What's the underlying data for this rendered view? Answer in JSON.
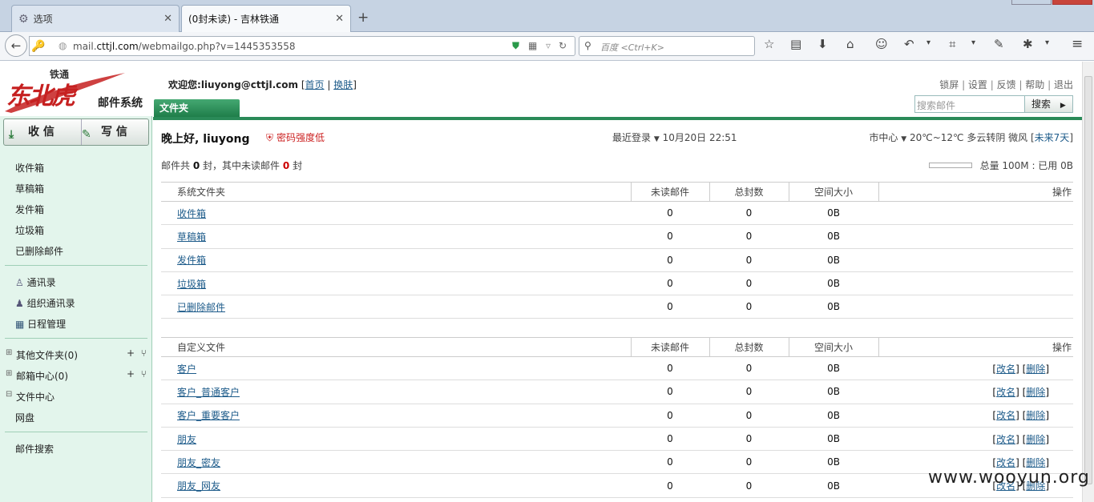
{
  "browser": {
    "tabs": [
      {
        "label": "选项"
      },
      {
        "label": "(0封未读) - 吉林铁通"
      }
    ],
    "url_prefix": "mail.",
    "url_domain": "cttjl.com",
    "url_path": "/webmailgo.php?v=1445353558",
    "search_placeholder": "百度 <Ctrl+K>"
  },
  "logo": {
    "top_text": "铁通",
    "main_text": "东北虎",
    "sub_text": "邮件系统"
  },
  "sidebar": {
    "receive_label": "收 信",
    "write_label": "写 信",
    "mail_items": [
      "收件箱",
      "草稿箱",
      "发件箱",
      "垃圾箱",
      "已删除邮件"
    ],
    "tool_items": [
      "通讯录",
      "组织通讯录",
      "日程管理"
    ],
    "tree_items": [
      "其他文件夹(0)",
      "邮箱中心(0)",
      "文件中心"
    ],
    "netdisk": "网盘",
    "mail_search": "邮件搜索"
  },
  "header": {
    "welcome_prefix": "欢迎您:",
    "user_email": "liuyong@cttjl.com",
    "home_link": "首页",
    "skin_link": "换肤",
    "top_links": [
      "锁屏",
      "设置",
      "反馈",
      "帮助",
      "退出"
    ],
    "search_placeholder": "搜索邮件",
    "search_button": "搜索",
    "folder_tab": "文件夹"
  },
  "main": {
    "greeting": "晚上好, liuyong",
    "password_warning": "密码强度低",
    "last_login_label": "最近登录",
    "last_login_time": "10月20日 22:51",
    "city": "市中心",
    "weather": "20℃~12℃ 多云转阴 微风",
    "forecast_link": "未来7天",
    "summary_prefix": "邮件共",
    "summary_total": "0",
    "summary_mid": "封，其中未读邮件",
    "summary_unread": "0",
    "summary_suffix": "封",
    "quota_text": "总量 100M : 已用 0B"
  },
  "system_table": {
    "headers": [
      "系统文件夹",
      "未读邮件",
      "总封数",
      "空间大小",
      "操作"
    ],
    "rows": [
      {
        "name": "收件箱",
        "unread": "0",
        "total": "0",
        "size": "0B"
      },
      {
        "name": "草稿箱",
        "unread": "0",
        "total": "0",
        "size": "0B"
      },
      {
        "name": "发件箱",
        "unread": "0",
        "total": "0",
        "size": "0B"
      },
      {
        "name": "垃圾箱",
        "unread": "0",
        "total": "0",
        "size": "0B"
      },
      {
        "name": "已删除邮件",
        "unread": "0",
        "total": "0",
        "size": "0B"
      }
    ]
  },
  "custom_table": {
    "headers": [
      "自定义文件",
      "未读邮件",
      "总封数",
      "空间大小",
      "操作"
    ],
    "rename": "改名",
    "delete": "删除",
    "rows": [
      {
        "name": "客户",
        "unread": "0",
        "total": "0",
        "size": "0B"
      },
      {
        "name": "客户_普通客户",
        "unread": "0",
        "total": "0",
        "size": "0B"
      },
      {
        "name": "客户_重要客户",
        "unread": "0",
        "total": "0",
        "size": "0B"
      },
      {
        "name": "朋友",
        "unread": "0",
        "total": "0",
        "size": "0B"
      },
      {
        "name": "朋友_密友",
        "unread": "0",
        "total": "0",
        "size": "0B"
      },
      {
        "name": "朋友_网友",
        "unread": "0",
        "total": "0",
        "size": "0B"
      }
    ]
  },
  "watermark": "www.wooyun.org",
  "colors": {
    "accent_green": "#2a8a58",
    "sidebar_bg": "#e3f5ec",
    "warning_red": "#cc2222"
  }
}
